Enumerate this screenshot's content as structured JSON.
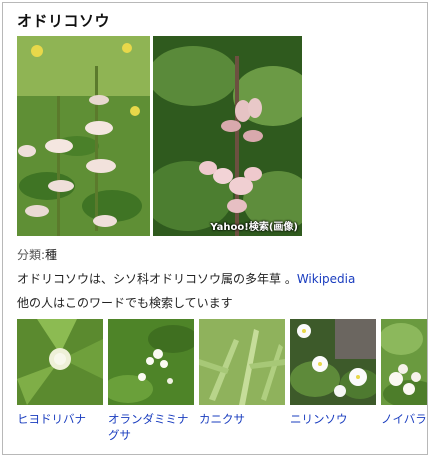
{
  "panel": {
    "title": "オドリコソウ",
    "image_credit": "Yahoo!検索(画像)",
    "category_label": "分類:",
    "category_value": "種",
    "description": "オドリコソウは、シソ科オドリコソウ属の多年草 。",
    "wikipedia_link": "Wikipedia",
    "related_heading": "他の人はこのワードでも検索しています",
    "related": [
      {
        "label": "ヒヨドリバナ",
        "icon": "hiyodoribana-photo"
      },
      {
        "label": "オランダミミナグサ",
        "icon": "orandamiminagusa-photo"
      },
      {
        "label": "カニクサ",
        "icon": "kanikusa-photo"
      },
      {
        "label": "ニリンソウ",
        "icon": "nirinsou-photo"
      },
      {
        "label": "ノイバラ",
        "icon": "noibara-photo"
      }
    ]
  },
  "colors": {
    "link": "#1a3dbf",
    "border": "#b8b8b8",
    "leaf_green": "#4f8a2a",
    "flower_pink": "#f2d3d6"
  }
}
